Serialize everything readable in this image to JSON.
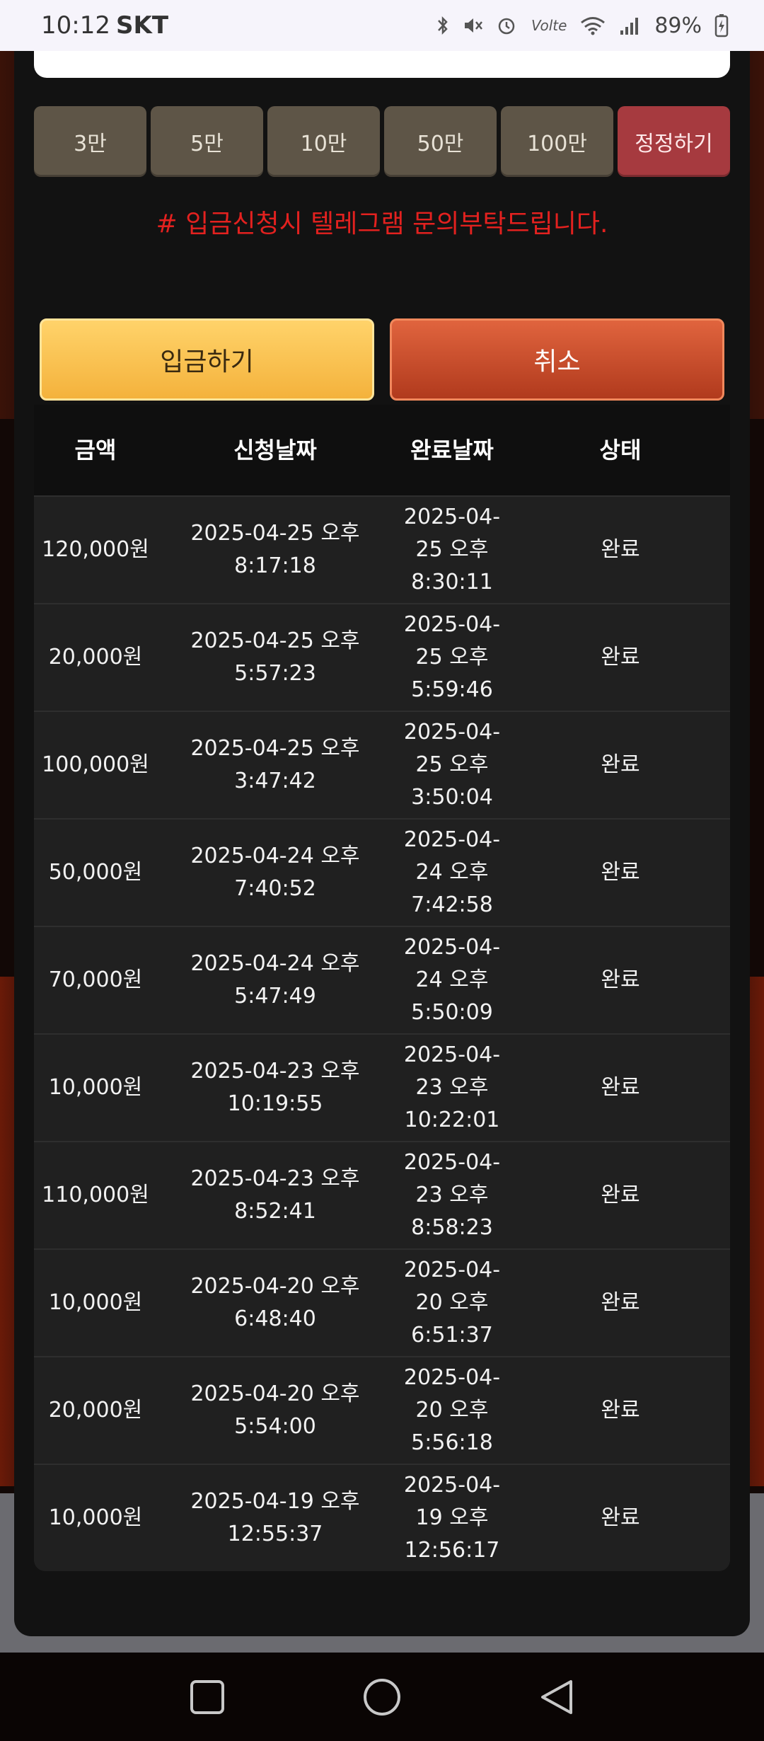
{
  "status_bar": {
    "time": "10:12",
    "carrier": "SKT",
    "battery": "89%",
    "icons": [
      "bluetooth-icon",
      "mute-icon",
      "alarm-icon",
      "volte-icon",
      "wifi-icon",
      "signal-icon",
      "battery-icon"
    ]
  },
  "amount_buttons": [
    "3만",
    "5만",
    "10만",
    "50만",
    "100만"
  ],
  "reset_button": "정정하기",
  "notice": "# 입금신청시 텔레그램 문의부탁드립니다.",
  "actions": {
    "deposit": "입금하기",
    "cancel": "취소"
  },
  "table": {
    "headers": {
      "amount": "금액",
      "request_date": "신청날짜",
      "complete_date": "완료날짜",
      "status": "상태"
    },
    "rows": [
      {
        "amount": "120,000원",
        "request": "2025-04-25 오후 8:17:18",
        "complete": "2025-04-25 오후 8:30:11",
        "status": "완료"
      },
      {
        "amount": "20,000원",
        "request": "2025-04-25 오후 5:57:23",
        "complete": "2025-04-25 오후 5:59:46",
        "status": "완료"
      },
      {
        "amount": "100,000원",
        "request": "2025-04-25 오후 3:47:42",
        "complete": "2025-04-25 오후 3:50:04",
        "status": "완료"
      },
      {
        "amount": "50,000원",
        "request": "2025-04-24 오후 7:40:52",
        "complete": "2025-04-24 오후 7:42:58",
        "status": "완료"
      },
      {
        "amount": "70,000원",
        "request": "2025-04-24 오후 5:47:49",
        "complete": "2025-04-24 오후 5:50:09",
        "status": "완료"
      },
      {
        "amount": "10,000원",
        "request": "2025-04-23 오후 10:19:55",
        "complete": "2025-04-23 오후 10:22:01",
        "status": "완료"
      },
      {
        "amount": "110,000원",
        "request": "2025-04-23 오후 8:52:41",
        "complete": "2025-04-23 오후 8:58:23",
        "status": "완료"
      },
      {
        "amount": "10,000원",
        "request": "2025-04-20 오후 6:48:40",
        "complete": "2025-04-20 오후 6:51:37",
        "status": "완료"
      },
      {
        "amount": "20,000원",
        "request": "2025-04-20 오후 5:54:00",
        "complete": "2025-04-20 오후 5:56:18",
        "status": "완료"
      },
      {
        "amount": "10,000원",
        "request": "2025-04-19 오후 12:55:37",
        "complete": "2025-04-19 오후 12:56:17",
        "status": "완료"
      }
    ]
  },
  "nav": {
    "icons": [
      "recents-icon",
      "home-icon",
      "back-icon"
    ]
  }
}
